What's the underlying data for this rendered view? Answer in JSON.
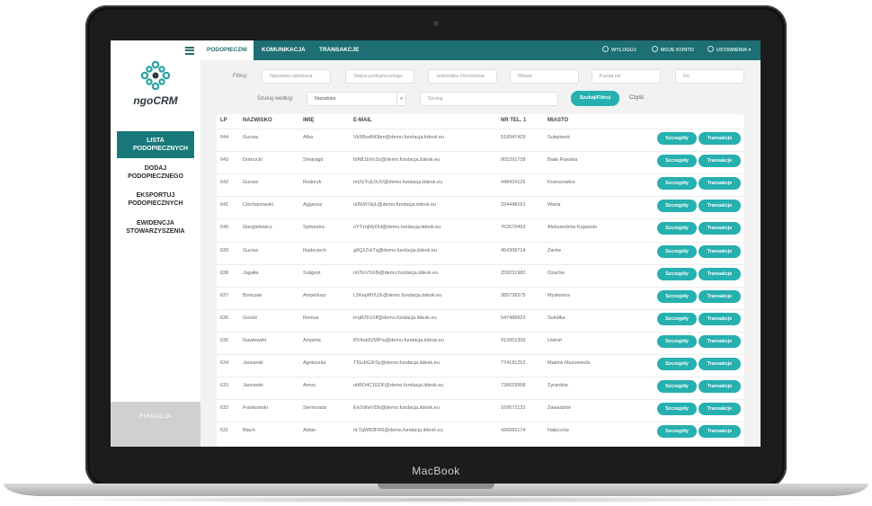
{
  "device": {
    "label": "MacBook"
  },
  "app": {
    "logo_text": "ngoCRM",
    "accent": "#1d6f73",
    "button_color": "#26b0b0"
  },
  "sidebar": {
    "items": [
      {
        "label": "LISTA PODOPIECZNYCH",
        "active": true
      },
      {
        "label": "DODAJ PODOPIECZNEGO",
        "active": false
      },
      {
        "label": "EKSPORTUJ PODOPIECZNYCH",
        "active": false
      },
      {
        "label": "EWIDENCJA STOWARZYSZENIA",
        "active": false
      }
    ],
    "footer": "FUNDACJA"
  },
  "topbar": {
    "tabs": [
      {
        "label": "PODOPIECZNI",
        "active": true
      },
      {
        "label": "KOMUNIKACJA",
        "active": false
      },
      {
        "label": "TRANSAKCJE",
        "active": false
      }
    ],
    "right": [
      {
        "label": "WYLOGUJ",
        "icon": "power-icon"
      },
      {
        "label": "MOJE KONTO",
        "icon": "user-icon"
      },
      {
        "label": "USTAWIENIA",
        "icon": "gear-icon"
      }
    ]
  },
  "filters": {
    "filter_label": "Filtruj:",
    "fields": [
      {
        "placeholder": "Nazwisko opiekuna"
      },
      {
        "placeholder": "Status podopiecznego"
      },
      {
        "placeholder": "Jednostka chorobowa"
      },
      {
        "placeholder": "Miasto"
      },
      {
        "placeholder": "Kwota od"
      },
      {
        "placeholder": "Do"
      }
    ],
    "search_by_label": "Szukaj według:",
    "search_by_value": "Nazwisko",
    "search_placeholder": "Szukaj",
    "search_button": "Szukaj/Filtruj",
    "clear_button": "Czyść"
  },
  "table": {
    "columns": [
      "LP",
      "NAZWISKO",
      "IMIĘ",
      "E-MAIL",
      "NR TEL. 1",
      "MIASTO"
    ],
    "details_label": "Szczegóły",
    "transactions_label": "Transakcje",
    "rows": [
      {
        "lp": "644",
        "nazwisko": "Gucwa",
        "imie": "Alba",
        "email": "VkSBodNObm@demo.fundacja.itdesk.eu",
        "tel": "518947429",
        "miasto": "Sulejówek"
      },
      {
        "lp": "643",
        "nazwisko": "Dobrucki",
        "imie": "Smaragd",
        "email": "IbN81bXnSz@demo.fundacja.itdesk.eu",
        "tel": "965291728",
        "miasto": "Biała Rawska"
      },
      {
        "lp": "642",
        "nazwisko": "Gucwa",
        "imie": "Roderyk",
        "email": "mUUYvjUXJV@demo.fundacja.itdesk.eu",
        "tel": "448424125",
        "miasto": "Krzeszowice"
      },
      {
        "lp": "641",
        "nazwisko": "Ciechanowski",
        "imie": "Aggeusz",
        "email": "nII5iM7dyL@demo.fundacja.itdesk.eu",
        "tel": "334448161",
        "miasto": "Warta"
      },
      {
        "lp": "640",
        "nazwisko": "Giergielewicz",
        "imie": "Sylwestra",
        "email": "oYTznjNyOH@demo.fundacja.itdesk.eu",
        "tel": "762670493",
        "miasto": "Aleksandrów Kujawski"
      },
      {
        "lp": "639",
        "nazwisko": "Gucwa",
        "imie": "Radociech",
        "email": "g9Q2ZrkTq@demo.fundacja.itdesk.eu",
        "tel": "454308714",
        "miasto": "Żarów"
      },
      {
        "lp": "638",
        "nazwisko": "Jagałła",
        "imie": "Suligost",
        "email": "mI7loVSX8I@demo.fundacja.itdesk.eu",
        "tel": "259231982",
        "miasto": "Ozarów"
      },
      {
        "lp": "637",
        "nazwisko": "Bończak",
        "imie": "Ampeliusz",
        "email": "L5KepMVU3r@demo.fundacja.itdesk.eu",
        "tel": "385738375",
        "miasto": "Mysłowice"
      },
      {
        "lp": "636",
        "nazwisko": "Gondz",
        "imie": "Remus",
        "email": "tnqRZKz1ff@demo.fundacja.itdesk.eu",
        "tel": "547488923",
        "miasto": "Sokółka"
      },
      {
        "lp": "635",
        "nazwisko": "Gawłowski",
        "imie": "Ampelia",
        "email": "RV4ob52WPw@demo.fundacja.itdesk.eu",
        "tel": "913952309",
        "miasto": "Ustroń"
      },
      {
        "lp": "634",
        "nazwisko": "Janowski",
        "imie": "Agnieszka",
        "email": "TIGcbG3rSy@demo.fundacja.itdesk.eu",
        "tel": "774181252",
        "miasto": "Maków Mazowiecki"
      },
      {
        "lp": "633",
        "nazwisko": "Janowski",
        "imie": "Amos",
        "email": "nhBO4C1EDF@demo.fundacja.itdesk.eu",
        "tel": "736629958",
        "miasto": "Żyrardów"
      },
      {
        "lp": "632",
        "nazwisko": "Frankowski",
        "imie": "Siemoradz",
        "email": "Eiv2dheVDb@demo.fundacja.itdesk.eu",
        "tel": "169072122",
        "miasto": "Zawadzkie"
      },
      {
        "lp": "631",
        "nazwisko": "Błach",
        "imie": "Aidan",
        "email": "nLTgWB3FR6@demo.fundacja.itdesk.eu",
        "tel": "426066174",
        "miasto": "Nałęczów"
      }
    ]
  }
}
